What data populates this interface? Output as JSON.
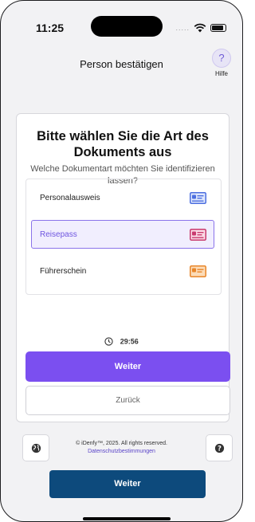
{
  "status_bar": {
    "time": "11:25",
    "signal_dots": "....."
  },
  "header": {
    "title": "Person bestätigen",
    "help_symbol": "?",
    "help_label": "Hilfe"
  },
  "card": {
    "title": "Bitte wählen Sie die Art des Dokuments aus",
    "subtitle": "Welche Dokumentart möchten Sie identifizieren lassen?",
    "documents": [
      {
        "label": "Personalausweis",
        "icon": "id-card-icon",
        "color": "#5a7ee8",
        "selected": false
      },
      {
        "label": "Reisepass",
        "icon": "passport-icon",
        "color": "#d4477a",
        "selected": true
      },
      {
        "label": "Führerschein",
        "icon": "driver-license-icon",
        "color": "#ec8f2c",
        "selected": false
      }
    ],
    "timer": "29:56",
    "primary_button": "Weiter",
    "secondary_button": "Zurück"
  },
  "footer": {
    "copyright": "© iDenfy™, 2025. All rights reserved.",
    "privacy_link": "Datenschutzbestimmungen"
  },
  "bottom_button": "Weiter",
  "colors": {
    "accent": "#7b4ff0",
    "bottom_button": "#0d4a7c",
    "selected_border": "#8a73ea"
  }
}
